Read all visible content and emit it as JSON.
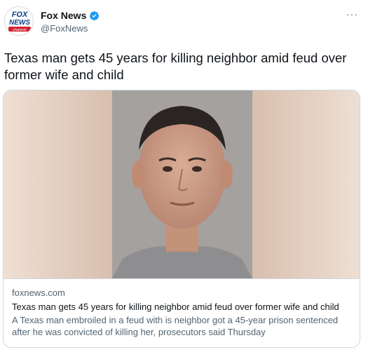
{
  "account": {
    "display_name": "Fox News",
    "handle": "@FoxNews",
    "verified": true,
    "avatar_text": [
      "FOX",
      "NEWS",
      "channel"
    ],
    "avatar_colors": {
      "blue": "#0b3f8c",
      "red": "#d21f2f"
    }
  },
  "header": {
    "more_label": "···"
  },
  "tweet": {
    "text": "Texas man gets 45 years for killing neighbor amid feud over former wife and child"
  },
  "card": {
    "domain": "foxnews.com",
    "title": "Texas man gets 45 years for killing neighbor amid feud over former wife and child",
    "description": "A Texas man embroiled in a feud with is neighbor got a 45-year prison sentenced after he was convicted of killing her, prosecutors said Thursday",
    "image_alt": "mugshot photo"
  },
  "colors": {
    "text_primary": "#0f1419",
    "text_secondary": "#536471",
    "border": "#cfd9de",
    "verified_blue": "#1d9bf0"
  }
}
